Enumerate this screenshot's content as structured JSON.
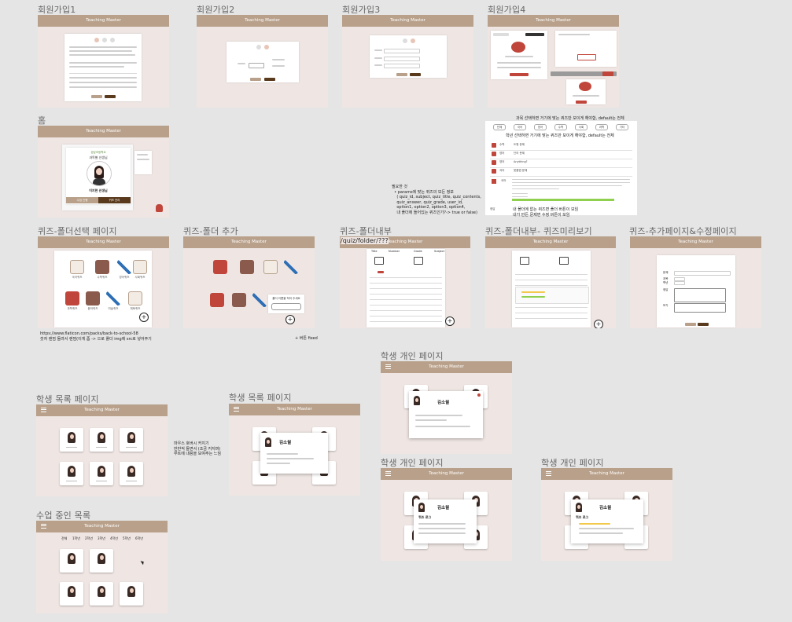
{
  "app_header": "Teaching Master",
  "labels": {
    "signup1": "회원가입1",
    "signup2": "회원가입2",
    "signup3": "회원가입3",
    "signup4": "회원가입4",
    "home": "홈",
    "quiz_folder_select": "퀴즈-폴더선택 페이지",
    "quiz_folder_add": "퀴즈-폴더 추가",
    "quiz_folder_inside": "퀴즈-폴더내부",
    "quiz_folder_preview": "퀴즈-폴더내부- 퀴즈미리보기",
    "quiz_add_edit": "퀴즈-추가페이지&수정페이지",
    "student_list_1": "학생 목록 페이지",
    "student_list_2": "학생 목록 페이지",
    "student_personal_1": "학생 개인  페이지",
    "student_personal_2": "학생 개인  페이지",
    "student_personal_3": "학생 개인  페이지",
    "class_list": "수업 중인 목록"
  },
  "notes": {
    "category_filter_top": "과목 선택하면 거기에 맞는 퀴즈만 보이게 해야함, default는 전체",
    "category_filter_inner": "학년 선택하면 거기에 맞는 퀴즈만 보이게 해야함, default는 전체",
    "required_info": "필요한 것\n  • params에 맞는 퀴즈의 모든 정보\n    ( quiz_id, subject, quiz_title, quiz_contents,\n    quiz_answer, quiz_grade, user_id,\n    option1, option2, option3, option4,\n    내 폴더에 들어있는 퀴즈인가?-> true or false)",
    "folder_buttons": "내 폴더에 없는 퀴즈면 폴더 버튼이 보임\n내가 만든 문제면 수정 버튼이 보임",
    "quiz_folder_url": "/quiz/folder/???",
    "flaticon_note": "https://www.flaticon.com/packs/back-to-school-58\n숫자 랜덤 돌려서 랜덤(이게 좀 -> 으로 폴더 img에 src로 넣어주기",
    "hover_note": "마우스 호버시 커지기\n반반씩 들면서 (조금 커지며)\n루트에 내용을 보여주는 느낌",
    "plus_fixed": "+ 버튼 fixed"
  },
  "home": {
    "school_name": "성남초등학교",
    "teacher_title": "과목별 선생님",
    "teacher_name": "이지현 선생님",
    "btn_left": "수업 진행",
    "btn_right": "퀴즈 관리"
  },
  "quiz_categories": [
    "전체",
    "국어",
    "영어",
    "수학",
    "사회",
    "과학",
    "기타"
  ],
  "quiz_rows": [
    {
      "subject": "수학",
      "title": "도형 문제"
    },
    {
      "subject": "영어",
      "title": "단어 문제"
    },
    {
      "subject": "영어",
      "title": "Anything?"
    },
    {
      "subject": "국어",
      "title": "맞춤법 문제"
    }
  ],
  "quiz_detail": {
    "subject": "국어",
    "answer_label": "정답"
  },
  "folder_items": [
    "국어퀴즈",
    "수학퀴즈",
    "영어퀴즈",
    "사회퀴즈",
    "과학퀴즈",
    "음악퀴즈",
    "미술퀴즈",
    "체육퀴즈"
  ],
  "folder_add_popup": "폴더 이름을 적어 주세요",
  "folder_inside_tabs": [
    "Title",
    "Number",
    "Grade",
    "Subject"
  ],
  "quiz_add_fields": [
    "문제",
    "과목",
    "학년",
    "정답",
    "보기"
  ],
  "students": {
    "name": "김소월",
    "section_title": "퀴즈 로그"
  },
  "class_tabs": [
    "전체",
    "1학년",
    "2학년",
    "3학년",
    "4학년",
    "5학년",
    "6학년"
  ],
  "colors": {
    "header": "#b8a08a",
    "frame_bg": "#efe6e3",
    "canvas": "#e5e5e5",
    "accent_brown": "#5a3a1d",
    "accent_red": "#c0463b"
  }
}
